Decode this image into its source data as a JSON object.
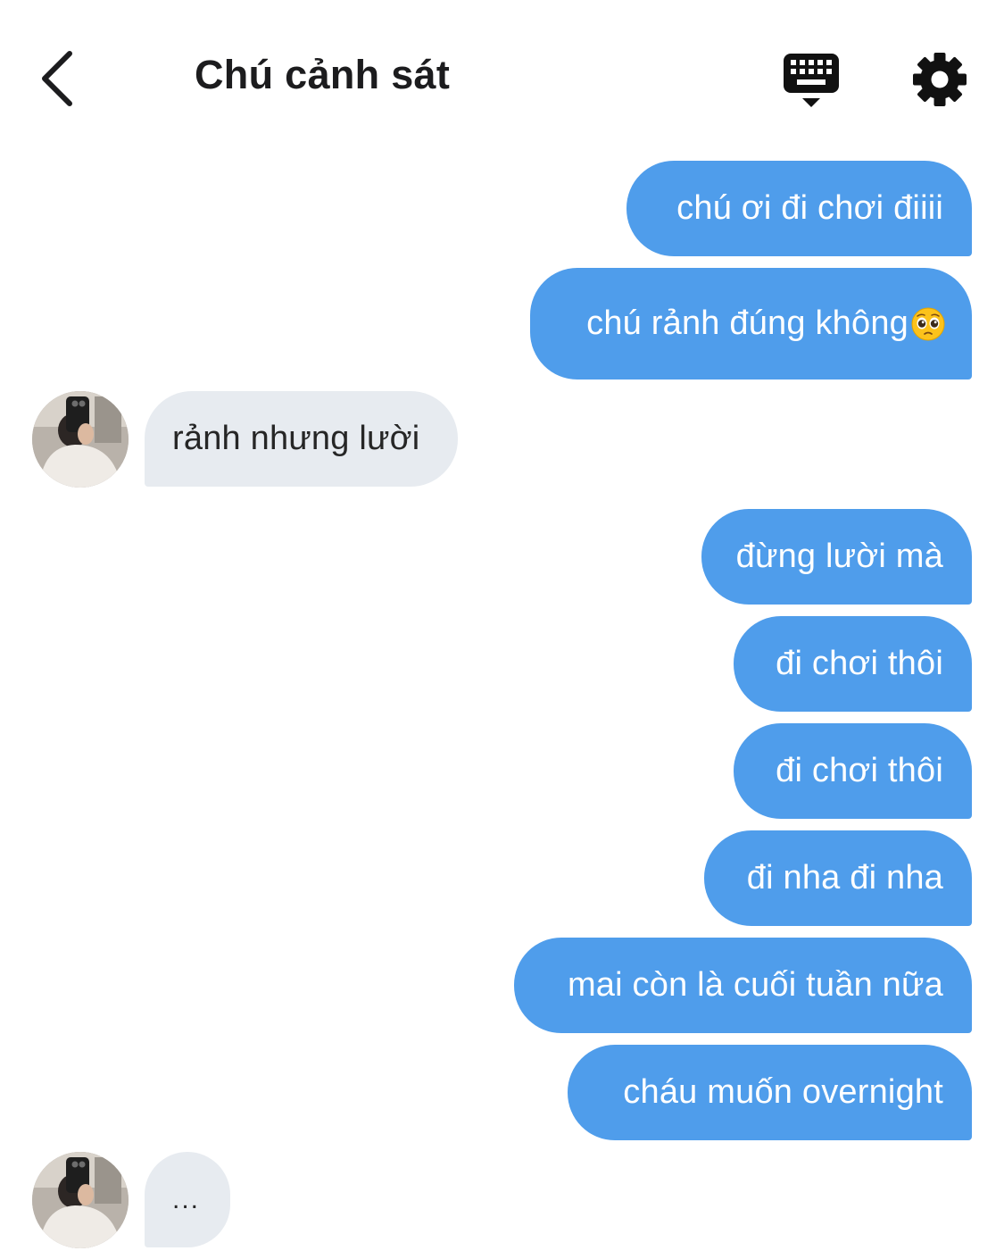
{
  "header": {
    "title": "Chú cảnh sát"
  },
  "messages": [
    {
      "direction": "out",
      "text": "chú ơi đi chơi điiii"
    },
    {
      "direction": "out",
      "text": "chú rảnh đúng không",
      "emoji": "pleading-face"
    },
    {
      "direction": "in",
      "text": "rảnh nhưng lười"
    },
    {
      "direction": "out",
      "text": "đừng lười mà"
    },
    {
      "direction": "out",
      "text": "đi chơi thôi"
    },
    {
      "direction": "out",
      "text": "đi chơi thôi"
    },
    {
      "direction": "out",
      "text": "đi nha đi nha"
    },
    {
      "direction": "out",
      "text": "mai còn là cuối tuần nữa"
    },
    {
      "direction": "out",
      "text": "cháu muốn overnight"
    },
    {
      "direction": "in",
      "text": "..."
    }
  ],
  "icons": {
    "back": "chevron-left-icon",
    "keyboard": "keyboard-icon",
    "settings": "gear-icon",
    "emoji": "pleading-face-icon"
  },
  "colors": {
    "outgoing_bubble": "#4f9deb",
    "incoming_bubble": "#e7ebf0",
    "title_text": "#1c1c1e",
    "background": "#ffffff"
  }
}
